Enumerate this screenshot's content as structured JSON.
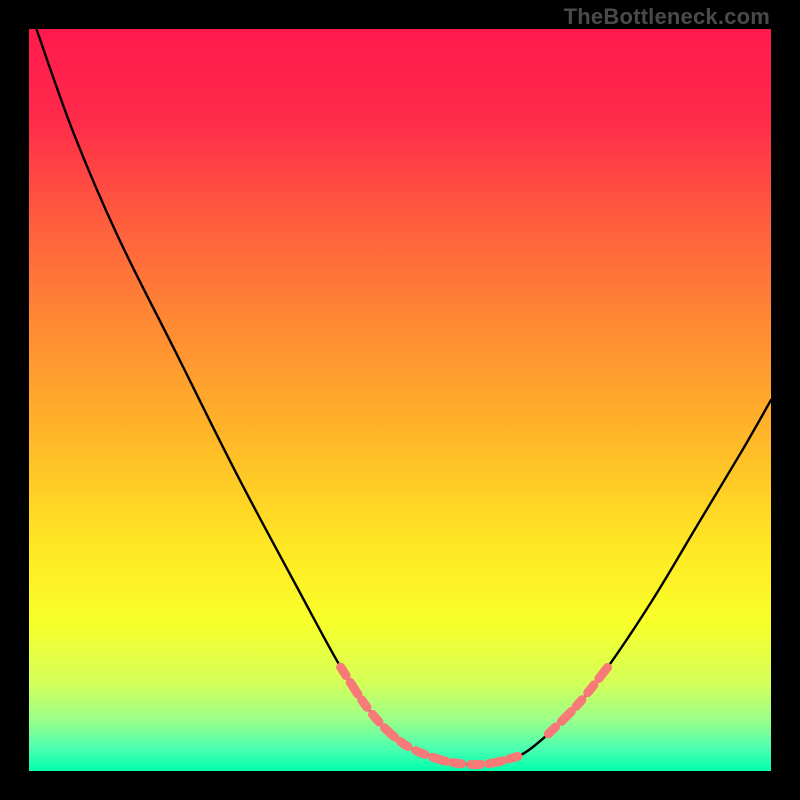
{
  "attribution": "TheBottleneck.com",
  "chart_data": {
    "type": "line",
    "title": "",
    "xlabel": "",
    "ylabel": "",
    "xlim": [
      0,
      100
    ],
    "ylim": [
      0,
      100
    ],
    "gradient_stops": [
      {
        "offset": 0.0,
        "color": "#ff1a4d"
      },
      {
        "offset": 0.12,
        "color": "#ff2a4a"
      },
      {
        "offset": 0.25,
        "color": "#ff5a3e"
      },
      {
        "offset": 0.4,
        "color": "#ff8a33"
      },
      {
        "offset": 0.55,
        "color": "#ffb728"
      },
      {
        "offset": 0.7,
        "color": "#ffe824"
      },
      {
        "offset": 0.8,
        "color": "#f8ff2a"
      },
      {
        "offset": 0.88,
        "color": "#d5ff58"
      },
      {
        "offset": 0.93,
        "color": "#9cff88"
      },
      {
        "offset": 0.97,
        "color": "#4affb0"
      },
      {
        "offset": 1.0,
        "color": "#00ffae"
      }
    ],
    "series": [
      {
        "name": "bottleneck-curve",
        "points": [
          {
            "x": 1,
            "y": 100
          },
          {
            "x": 6,
            "y": 86
          },
          {
            "x": 12,
            "y": 72
          },
          {
            "x": 20,
            "y": 56
          },
          {
            "x": 28,
            "y": 40
          },
          {
            "x": 36,
            "y": 25
          },
          {
            "x": 42,
            "y": 14
          },
          {
            "x": 46,
            "y": 8
          },
          {
            "x": 50,
            "y": 4
          },
          {
            "x": 54,
            "y": 2
          },
          {
            "x": 58,
            "y": 1
          },
          {
            "x": 62,
            "y": 1
          },
          {
            "x": 66,
            "y": 2
          },
          {
            "x": 70,
            "y": 5
          },
          {
            "x": 74,
            "y": 9
          },
          {
            "x": 78,
            "y": 14
          },
          {
            "x": 84,
            "y": 23
          },
          {
            "x": 90,
            "y": 33
          },
          {
            "x": 96,
            "y": 43
          },
          {
            "x": 100,
            "y": 50
          }
        ]
      }
    ],
    "highlight_segments": [
      {
        "name": "left-highlight",
        "points": [
          {
            "x": 42,
            "y": 14
          },
          {
            "x": 46,
            "y": 8
          },
          {
            "x": 50,
            "y": 4
          },
          {
            "x": 54,
            "y": 2
          },
          {
            "x": 58,
            "y": 1
          },
          {
            "x": 62,
            "y": 1
          },
          {
            "x": 66,
            "y": 2
          }
        ]
      },
      {
        "name": "right-highlight",
        "points": [
          {
            "x": 70,
            "y": 5
          },
          {
            "x": 74,
            "y": 9
          },
          {
            "x": 78,
            "y": 14
          }
        ]
      }
    ],
    "highlight_color": "#f77a78"
  }
}
